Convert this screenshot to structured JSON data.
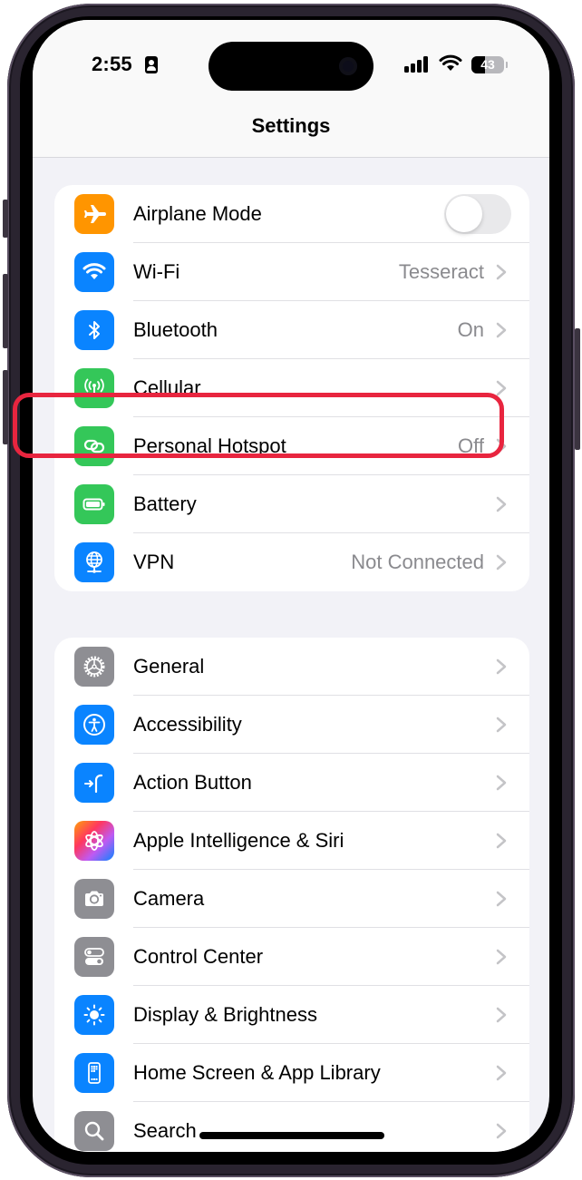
{
  "status_bar": {
    "time": "2:55",
    "battery_percent": "43",
    "battery_level": 0.43,
    "signal_bars": 4,
    "icons": [
      "id-card-icon",
      "cellular-signal-icon",
      "wifi-icon",
      "battery-icon"
    ]
  },
  "nav": {
    "title": "Settings"
  },
  "groups": [
    {
      "items": [
        {
          "label": "Airplane Mode",
          "icon": "airplane-icon",
          "color": "#ff9500",
          "control": "toggle",
          "toggle_on": false
        },
        {
          "label": "Wi-Fi",
          "icon": "wifi-icon",
          "color": "#0a84ff",
          "value": "Tesseract"
        },
        {
          "label": "Bluetooth",
          "icon": "bluetooth-icon",
          "color": "#0a84ff",
          "value": "On"
        },
        {
          "label": "Cellular",
          "icon": "cellular-antenna-icon",
          "color": "#34c759"
        },
        {
          "label": "Personal Hotspot",
          "icon": "link-icon",
          "color": "#34c759",
          "value": "Off",
          "highlighted": true
        },
        {
          "label": "Battery",
          "icon": "battery-icon",
          "color": "#34c759"
        },
        {
          "label": "VPN",
          "icon": "globe-network-icon",
          "color": "#0a84ff",
          "value": "Not Connected"
        }
      ]
    },
    {
      "items": [
        {
          "label": "General",
          "icon": "gear-icon",
          "color": "#8e8e93"
        },
        {
          "label": "Accessibility",
          "icon": "accessibility-icon",
          "color": "#0a84ff"
        },
        {
          "label": "Action Button",
          "icon": "action-button-icon",
          "color": "#0a84ff"
        },
        {
          "label": "Apple Intelligence & Siri",
          "icon": "apple-intelligence-icon",
          "color": "gradient"
        },
        {
          "label": "Camera",
          "icon": "camera-icon",
          "color": "#8e8e93"
        },
        {
          "label": "Control Center",
          "icon": "switches-icon",
          "color": "#8e8e93"
        },
        {
          "label": "Display & Brightness",
          "icon": "sun-icon",
          "color": "#0a84ff"
        },
        {
          "label": "Home Screen & App Library",
          "icon": "phone-grid-icon",
          "color": "#0a84ff"
        },
        {
          "label": "Search",
          "icon": "magnifier-icon",
          "color": "#8e8e93"
        }
      ]
    }
  ],
  "annotation": {
    "highlight_color": "#e8253f",
    "highlighted_item": "Personal Hotspot"
  }
}
